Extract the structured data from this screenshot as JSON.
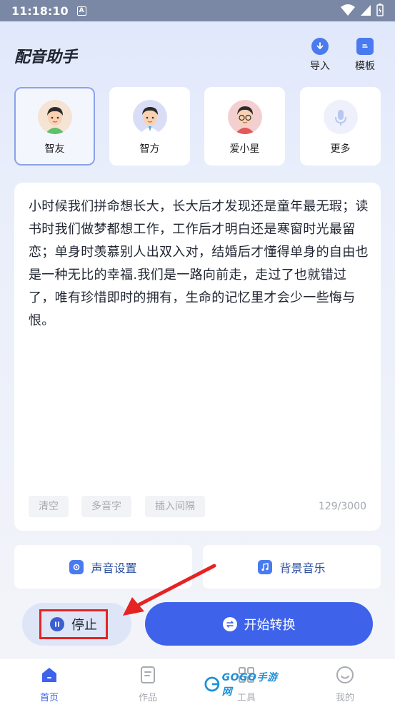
{
  "status_bar": {
    "time": "11:18:10",
    "indicator": "A"
  },
  "header": {
    "title": "配音助手",
    "actions": [
      {
        "label": "导入",
        "icon": "download-icon"
      },
      {
        "label": "模板",
        "icon": "template-icon"
      }
    ]
  },
  "voices": [
    {
      "name": "智友",
      "selected": true
    },
    {
      "name": "智方",
      "selected": false
    },
    {
      "name": "爱小星",
      "selected": false
    },
    {
      "name": "更多",
      "selected": false
    }
  ],
  "editor": {
    "text": "小时候我们拼命想长大，长大后才发现还是童年最无瑕；读书时我们做梦都想工作，工作后才明白还是寒窗时光最留恋；单身时羡慕别人出双入对，结婚后才懂得单身的自由也是一种无比的幸福.我们是一路向前走，走过了也就错过了，唯有珍惜即时的拥有，生命的记忆里才会少一些悔与恨。",
    "chips": [
      "清空",
      "多音字",
      "插入间隔"
    ],
    "counter": "129/3000"
  },
  "settings": {
    "voice_settings": "声音设置",
    "background_music": "背景音乐"
  },
  "controls": {
    "stop": "停止",
    "convert": "开始转换"
  },
  "nav": [
    {
      "label": "首页",
      "active": true
    },
    {
      "label": "作品",
      "active": false
    },
    {
      "label": "工具",
      "active": false
    },
    {
      "label": "我的",
      "active": false
    }
  ],
  "watermark": "GOGO手游网",
  "colors": {
    "accent": "#3e63ea",
    "highlight": "#e52323"
  }
}
